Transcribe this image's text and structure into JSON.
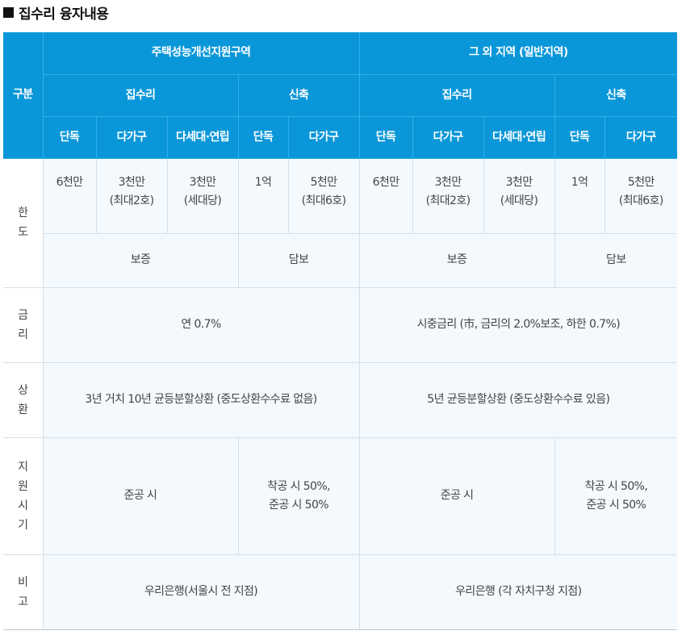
{
  "title": "집수리 융자내용",
  "header": {
    "category": "구분",
    "zone_a": "주택성능개선지원구역",
    "zone_b": "그 외 지역 (일반지역)",
    "repair": "집수리",
    "new_build": "신축",
    "types": {
      "single": "단독",
      "multi_family": "다가구",
      "multi_unit": "다세대·연립"
    }
  },
  "rows": {
    "limit": {
      "label": "한도",
      "single": "6천만",
      "multi_family": [
        "3천만",
        "(최대2호)"
      ],
      "multi_unit": [
        "3천만",
        "(세대당)"
      ],
      "new_single": "1억",
      "new_multi_family": [
        "5천만",
        "(최대6호)"
      ],
      "guarantee": "보증",
      "collateral": "담보"
    },
    "rate": {
      "label": "금리",
      "zone_a": "연 0.7%",
      "zone_b": "시중금리 (市, 금리의 2.0%보조, 하한 0.7%)"
    },
    "repay": {
      "label": "상환",
      "zone_a": "3년 거치 10년 균등분할상환 (중도상환수수료 없음)",
      "zone_b": "5년 균등분할상환 (중도상환수수료 있음)"
    },
    "timing": {
      "label": "지원시기",
      "repair": "준공 시",
      "new_build": [
        "착공 시 50%,",
        "준공 시 50%"
      ]
    },
    "note": {
      "label": "비고",
      "zone_a": "우리은행(서울시 전 지점)",
      "zone_b": "우리은행 (각 자치구청 지점)"
    }
  }
}
